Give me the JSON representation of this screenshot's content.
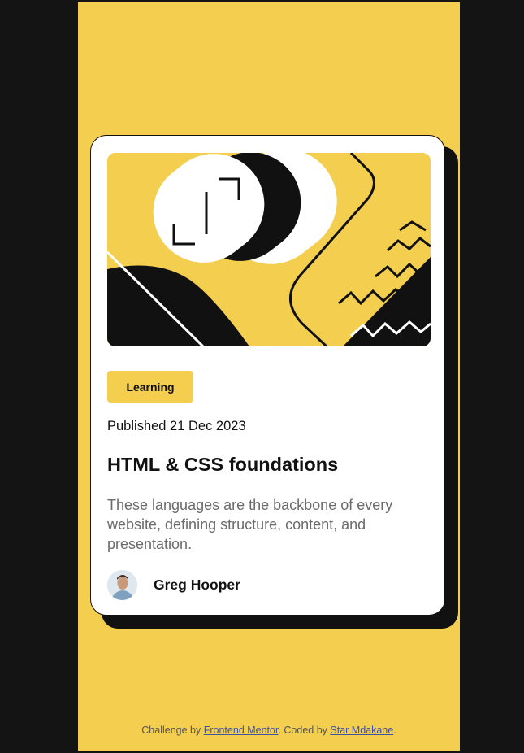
{
  "card": {
    "tag": "Learning",
    "published": "Published 21 Dec 2023",
    "title": "HTML & CSS foundations",
    "description": "These languages are the backbone of every website, defining structure, content, and presentation.",
    "author": "Greg Hooper",
    "illustration_icon": "illustration-article",
    "avatar_icon": "avatar-image"
  },
  "footer": {
    "prefix": "Challenge by ",
    "link1": "Frontend Mentor",
    "middle": ". Coded by ",
    "link2": "Star Mdakane",
    "suffix": "."
  },
  "colors": {
    "page_background": "#141414",
    "brand_yellow": "#F4CE4E",
    "card_background": "#FFFFFF",
    "ink": "#111111",
    "muted_text": "#6B6B6B",
    "link": "#3E52A3"
  }
}
